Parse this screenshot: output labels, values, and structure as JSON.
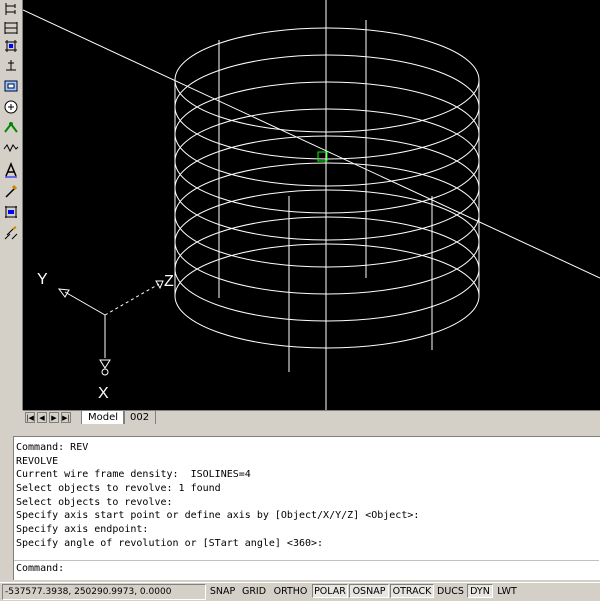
{
  "toolbar": {
    "buttons": [
      "dimension-ordinate-icon",
      "dimension-baseline-icon",
      "dimension-continue-icon",
      "quick-leader-icon",
      "tolerance-icon",
      "center-mark-icon",
      "dimension-edit-icon",
      "dimension-text-edit-icon",
      "dimension-update-icon",
      "dimension-style-icon",
      "dimension-override-icon",
      "dimension-linear-icon"
    ]
  },
  "viewport": {
    "ucs_labels": {
      "x": "X",
      "y": "Y",
      "z": "Z"
    },
    "background": "#000000",
    "wire_color": "#ffffff",
    "cursor_color": "#00ff00"
  },
  "tabs": {
    "model": "Model",
    "layout": "002",
    "nav": [
      "|◀",
      "◀",
      "▶",
      "▶|"
    ]
  },
  "command": {
    "history": [
      "Command: REV",
      "REVOLVE",
      "Current wire frame density:  ISOLINES=4",
      "Select objects to revolve: 1 found",
      "Select objects to revolve:",
      "Specify axis start point or define axis by [Object/X/Y/Z] <Object>:",
      "Specify axis endpoint:",
      "Specify angle of revolution or [STart angle] <360>:"
    ],
    "prompt": "Command:"
  },
  "status": {
    "coords": "-537577.3938, 250290.9973, 0.0000",
    "buttons": [
      {
        "label": "SNAP",
        "on": false
      },
      {
        "label": "GRID",
        "on": false
      },
      {
        "label": "ORTHO",
        "on": false
      },
      {
        "label": "POLAR",
        "on": true
      },
      {
        "label": "OSNAP",
        "on": true
      },
      {
        "label": "OTRACK",
        "on": true
      },
      {
        "label": "DUCS",
        "on": false
      },
      {
        "label": "DYN",
        "on": true
      },
      {
        "label": "LWT",
        "on": false
      }
    ]
  }
}
